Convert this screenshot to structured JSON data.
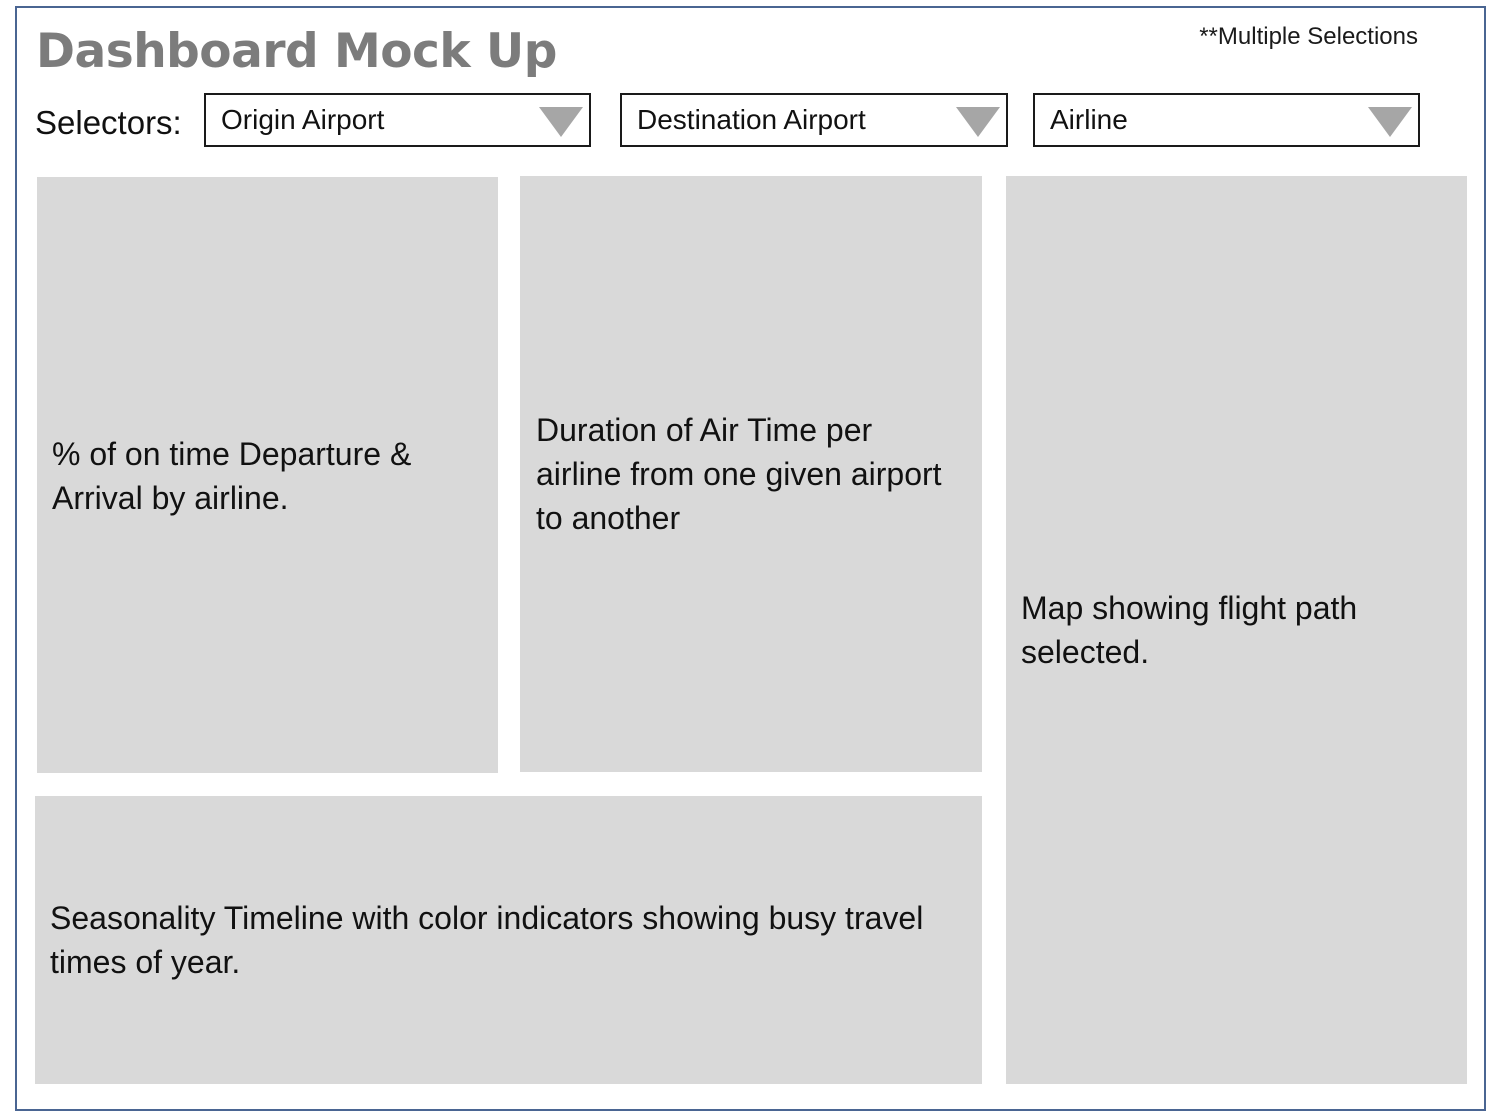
{
  "header": {
    "title": "Dashboard Mock Up",
    "note": "**Multiple Selections"
  },
  "selectors": {
    "label": "Selectors:",
    "items": [
      {
        "label": "Origin Airport"
      },
      {
        "label": "Destination Airport"
      },
      {
        "label": "Airline"
      }
    ],
    "arrow_icon": "triangle-down-icon"
  },
  "panels": {
    "ontime": "% of on time Departure & Arrival by airline.",
    "duration": "Duration of Air Time per airline from one given airport to another",
    "map": "Map showing flight path selected.",
    "seasonality": "Seasonality Timeline with color indicators showing busy travel times of year."
  },
  "colors": {
    "frame_border": "#4a6592",
    "title": "#7c7c7c",
    "panel_fill": "#d9d9d9",
    "arrow_fill": "#a6a6a6"
  }
}
